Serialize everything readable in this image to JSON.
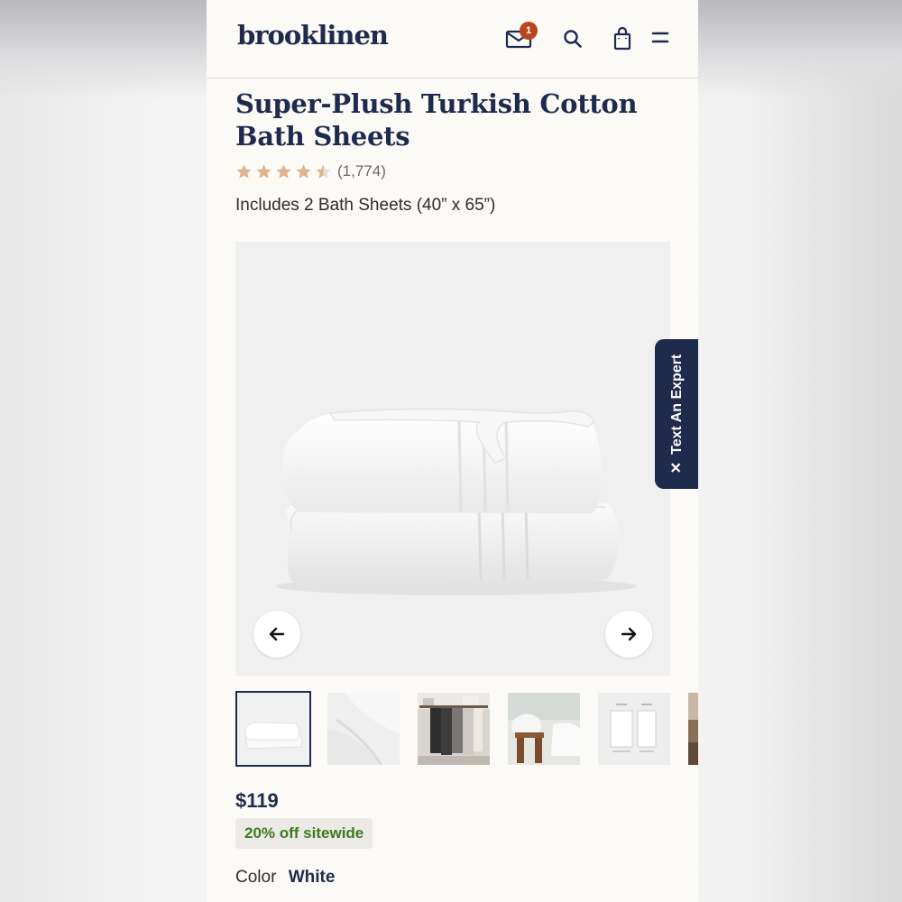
{
  "header": {
    "logo": "brooklinen",
    "mail_badge_count": "1",
    "icons": [
      "mail-icon",
      "search-icon",
      "bag-icon",
      "menu-icon"
    ]
  },
  "product": {
    "title": "Super-Plush Turkish Cotton Bath Sheets",
    "rating": 4.5,
    "rating_count": "(1,774)",
    "includes": "Includes 2 Bath Sheets (40” x 65”)",
    "price": "$119",
    "sale_badge": "20% off sitewide",
    "color_label": "Color",
    "color_value": "White"
  },
  "gallery": {
    "prev_icon": "arrow-left-icon",
    "next_icon": "arrow-right-icon",
    "thumbnails": [
      "folded-towels",
      "towel-closeup",
      "towels-on-rack",
      "towels-on-stool",
      "size-chart",
      "partial-thumbnail"
    ]
  },
  "expert_tab": {
    "label": "Text An Expert",
    "close_icon": "close-icon"
  },
  "colors": {
    "navy": "#1f2b4d",
    "badge_orange": "#b8461f",
    "sale_green": "#3d7a1f",
    "star": "#e0b48c"
  }
}
